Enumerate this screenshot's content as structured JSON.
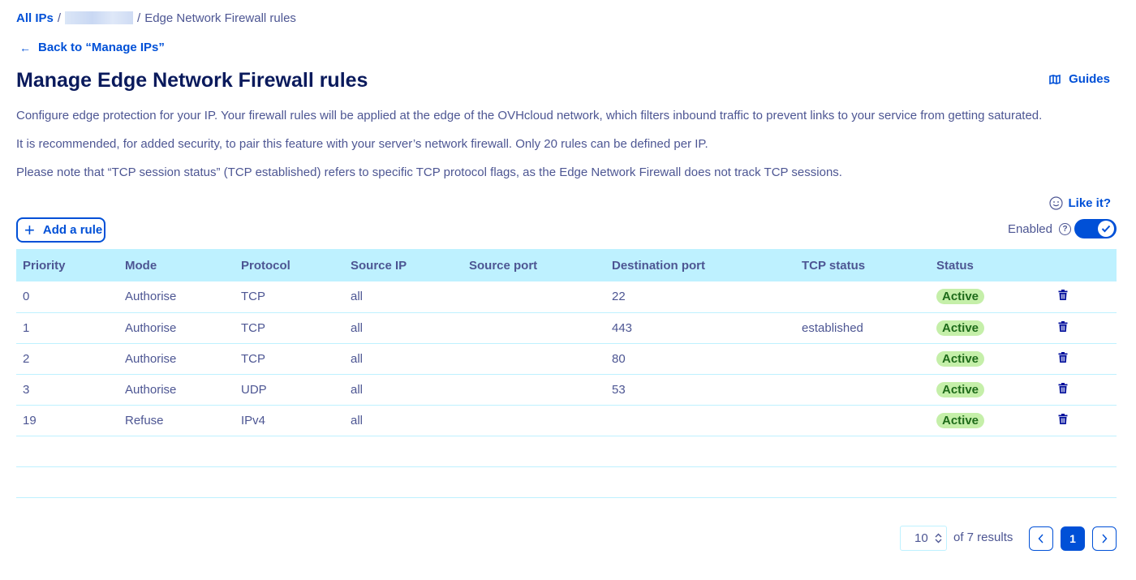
{
  "breadcrumb": {
    "root": "All IPs",
    "current": "Edge Network Firewall rules"
  },
  "back_link": "Back to “Manage IPs”",
  "title": "Manage Edge Network Firewall rules",
  "guides_label": "Guides",
  "descriptions": [
    "Configure edge protection for your IP. Your firewall rules will be applied at the edge of the OVHcloud network, which filters inbound traffic to prevent links to your service from getting saturated.",
    "It is recommended, for added security, to pair this feature with your server’s network firewall. Only 20 rules can be defined per IP.",
    "Please note that “TCP session status” (TCP established) refers to specific TCP protocol flags, as the Edge Network Firewall does not track TCP sessions."
  ],
  "like_it": "Like it?",
  "add_rule": "Add a rule",
  "enabled_label": "Enabled",
  "enabled": true,
  "table": {
    "columns": [
      "Priority",
      "Mode",
      "Protocol",
      "Source IP",
      "Source port",
      "Destination port",
      "TCP status",
      "Status",
      ""
    ],
    "rows": [
      {
        "priority": "0",
        "mode": "Authorise",
        "protocol": "TCP",
        "source_ip": "all",
        "source_port": "",
        "destination_port": "22",
        "tcp_status": "",
        "status": "Active"
      },
      {
        "priority": "1",
        "mode": "Authorise",
        "protocol": "TCP",
        "source_ip": "all",
        "source_port": "",
        "destination_port": "443",
        "tcp_status": "established",
        "status": "Active"
      },
      {
        "priority": "2",
        "mode": "Authorise",
        "protocol": "TCP",
        "source_ip": "all",
        "source_port": "",
        "destination_port": "80",
        "tcp_status": "",
        "status": "Active"
      },
      {
        "priority": "3",
        "mode": "Authorise",
        "protocol": "UDP",
        "source_ip": "all",
        "source_port": "",
        "destination_port": "53",
        "tcp_status": "",
        "status": "Active"
      },
      {
        "priority": "19",
        "mode": "Refuse",
        "protocol": "IPv4",
        "source_ip": "all",
        "source_port": "",
        "destination_port": "",
        "tcp_status": "",
        "status": "Active"
      }
    ]
  },
  "pagination": {
    "page_size": "10",
    "results_text": "of 7 results",
    "current_page": "1"
  },
  "colors": {
    "accent": "#0050d7",
    "header_bg": "#bef1ff",
    "text": "#4d5693",
    "badge_bg": "#c5efa9"
  }
}
